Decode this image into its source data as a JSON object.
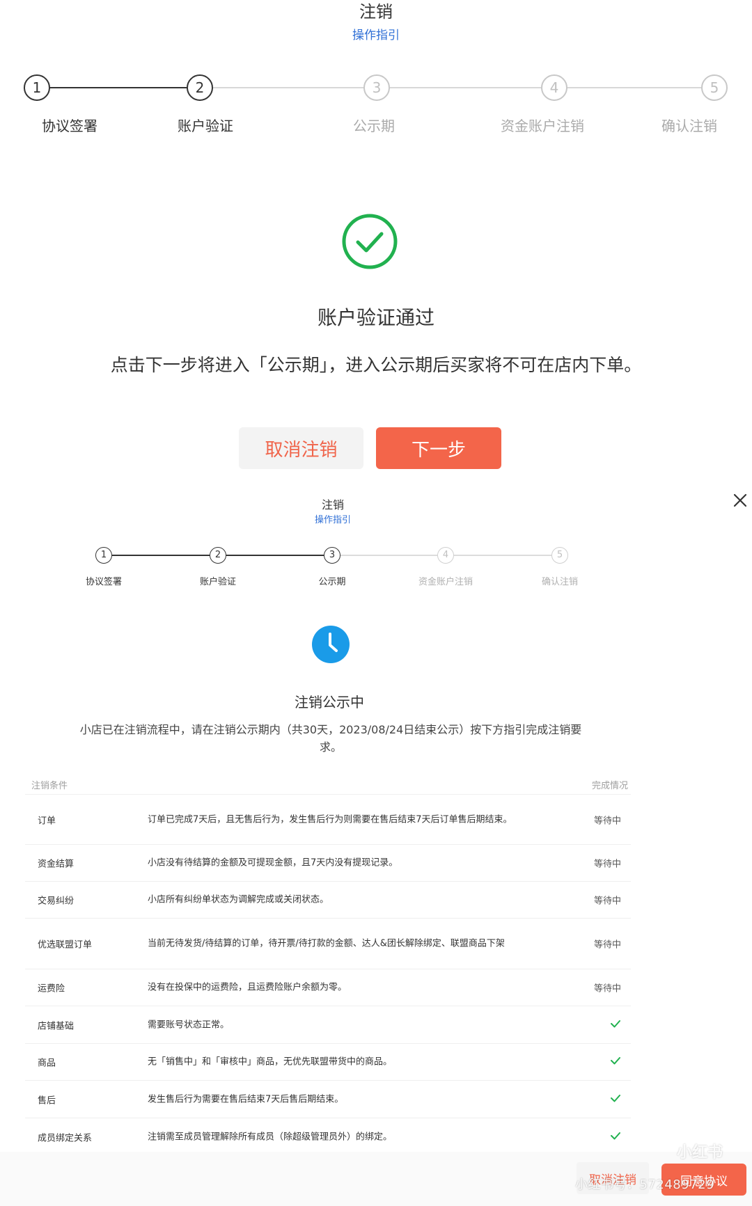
{
  "panel_a": {
    "title": "注销",
    "guide_link": "操作指引",
    "steps": [
      {
        "num": "1",
        "label": "协议签署",
        "state": "done"
      },
      {
        "num": "2",
        "label": "账户验证",
        "state": "current"
      },
      {
        "num": "3",
        "label": "公示期",
        "state": "todo"
      },
      {
        "num": "4",
        "label": "资金账户注销",
        "state": "todo"
      },
      {
        "num": "5",
        "label": "确认注销",
        "state": "todo"
      }
    ],
    "status_title": "账户验证通过",
    "description": "点击下一步将进入「公示期」，进入公示期后买家将不可在店内下单。",
    "cancel_button": "取消注销",
    "next_button": "下一步",
    "accent_color": "#f3654a",
    "success_color": "#21b14f"
  },
  "panel_b": {
    "title": "注销",
    "guide_link": "操作指引",
    "steps": [
      {
        "num": "1",
        "label": "协议签署",
        "state": "done"
      },
      {
        "num": "2",
        "label": "账户验证",
        "state": "done"
      },
      {
        "num": "3",
        "label": "公示期",
        "state": "current"
      },
      {
        "num": "4",
        "label": "资金账户注销",
        "state": "todo"
      },
      {
        "num": "5",
        "label": "确认注销",
        "state": "todo"
      }
    ],
    "status_title": "注销公示中",
    "description": "小店已在注销流程中，请在注销公示期内（共30天，2023/08/24日结束公示）按下方指引完成注销要求。",
    "table": {
      "col_condition": "注销条件",
      "col_status": "完成情况",
      "rows": [
        {
          "name": "订单",
          "desc": "订单已完成7天后，且无售后行为，发生售后行为则需要在售后结束7天后订单售后期结束。",
          "status": "等待中"
        },
        {
          "name": "资金结算",
          "desc": "小店没有待结算的金额及可提现金额，且7天内没有提现记录。",
          "status": "等待中"
        },
        {
          "name": "交易纠纷",
          "desc": "小店所有纠纷单状态为调解完成或关闭状态。",
          "status": "等待中"
        },
        {
          "name": "优选联盟订单",
          "desc": "当前无待发货/待结算的订单，待开票/待打款的金额、达人&团长解除绑定、联盟商品下架",
          "status": "等待中"
        },
        {
          "name": "运费险",
          "desc": "没有在投保中的运费险，且运费险账户余额为零。",
          "status": "等待中"
        },
        {
          "name": "店铺基础",
          "desc": "需要账号状态正常。",
          "status": "check"
        },
        {
          "name": "商品",
          "desc": "无「销售中」和「审核中」商品，无优先联盟带货中的商品。",
          "status": "check"
        },
        {
          "name": "售后",
          "desc": "发生售后行为需要在售后结束7天后售后期结束。",
          "status": "check"
        },
        {
          "name": "成员绑定关系",
          "desc": "注销需至成员管理解除所有成员（除超级管理员外）的绑定。",
          "status": "check"
        }
      ]
    },
    "footer_cancel": "取消注销",
    "footer_confirm": "同意协议",
    "clock_color": "#1a9be8"
  },
  "watermark": {
    "logo": "小红书",
    "id_text": "小红书号：572489729"
  }
}
